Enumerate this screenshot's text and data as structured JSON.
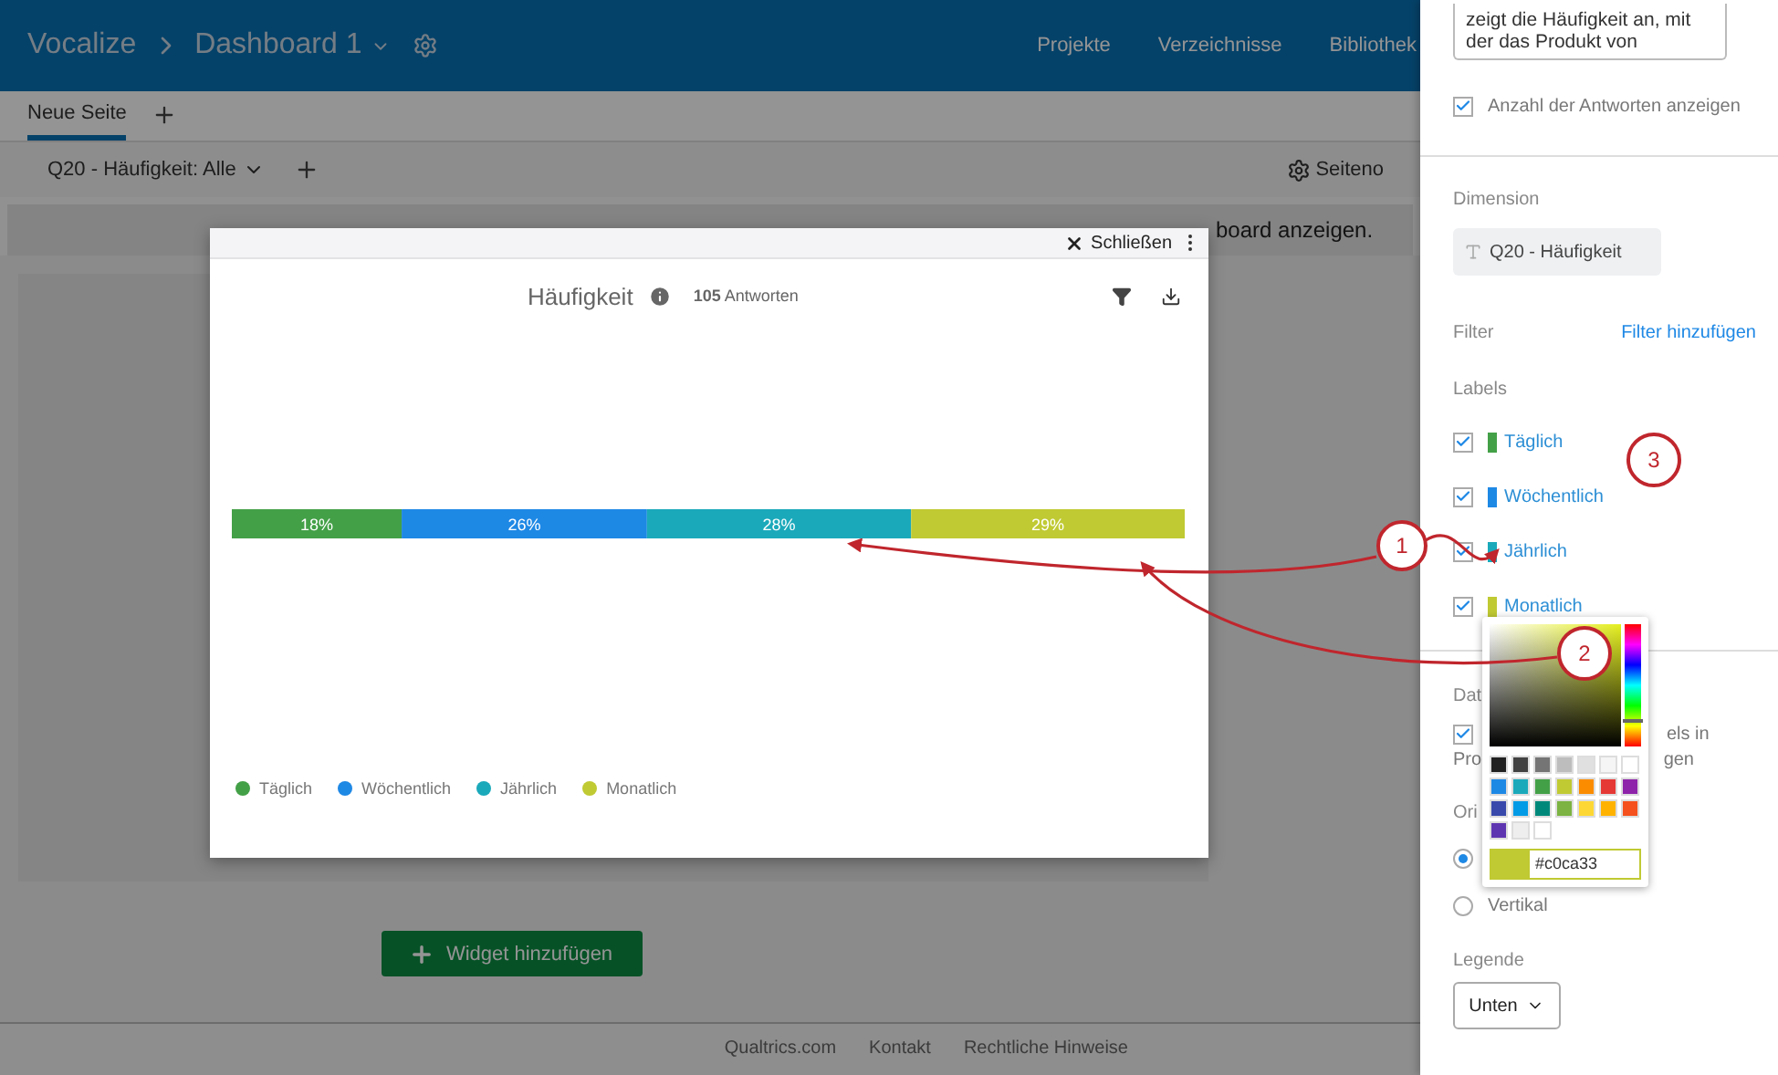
{
  "header": {
    "app": "Vocalize",
    "dashboard": "Dashboard 1",
    "nav": [
      "Projekte",
      "Verzeichnisse",
      "Bibliothek"
    ]
  },
  "page_tabs": [
    {
      "label": "Neue Seite",
      "selected": true
    }
  ],
  "filter_bar": {
    "filter": "Q20 - Häufigkeit: Alle",
    "settings": "Seiteno"
  },
  "banner": {
    "text": "board anzeigen."
  },
  "widget_button": "Widget hinzufügen",
  "footer": [
    "Qualtrics.com",
    "Kontakt",
    "Rechtliche Hinweise"
  ],
  "modal": {
    "close": "Schließen",
    "title": "Häufigkeit",
    "count": "105",
    "count_label": "Antworten",
    "chart_data": {
      "type": "bar",
      "orientation": "horizontal",
      "stacked": true,
      "data_labels": "value_labels",
      "series": [
        {
          "name": "Täglich",
          "color": "#43a047",
          "values": [
            18
          ],
          "value_labels": [
            "18%"
          ]
        },
        {
          "name": "Wöchentlich",
          "color": "#1e88e5",
          "values": [
            26
          ],
          "value_labels": [
            "26%"
          ]
        },
        {
          "name": "Jährlich",
          "color": "#1aa9bb",
          "values": [
            28
          ],
          "value_labels": [
            "28%"
          ]
        },
        {
          "name": "Monatlich",
          "color": "#c0ca33",
          "values": [
            29
          ],
          "value_labels": [
            "29%"
          ]
        }
      ]
    }
  },
  "panel": {
    "description_lines": [
      "zeigt die Häufigkeit an, mit",
      "der das Produkt von"
    ],
    "show_count": {
      "label": "Anzahl der Antworten anzeigen",
      "checked": true
    },
    "dimension_title": "Dimension",
    "dimension": "Q20 - Häufigkeit",
    "filter_title": "Filter",
    "filter_link": "Filter hinzufügen",
    "labels_title": "Labels",
    "labels": [
      {
        "label": "Täglich",
        "color": "#43a047",
        "checked": true
      },
      {
        "label": "Wöchentlich",
        "color": "#1e88e5",
        "checked": true
      },
      {
        "label": "Jährlich",
        "color": "#1aa9bb",
        "checked": true
      },
      {
        "label": "Monatlich",
        "color": "#c0ca33",
        "checked": true
      }
    ],
    "data_title": "Dat",
    "percent_option": {
      "checked": true,
      "fragments": [
        "els in",
        "Pro",
        "gen"
      ]
    },
    "orientation_title": "Ori",
    "orientations": [
      {
        "selected": true
      },
      {
        "label": "Vertikal",
        "selected": false
      }
    ],
    "legend_title": "Legende",
    "legend_value": "Unten"
  },
  "color_picker": {
    "value": "#c0ca33",
    "hue": {
      "level": 0.22
    },
    "swatches": [
      {
        "color": "#212121"
      },
      {
        "color": "#424242"
      },
      {
        "color": "#757575"
      },
      {
        "color": "#bdbdbd"
      },
      {
        "color": "#e0e0e0"
      },
      {
        "color": "#f5f5f5"
      },
      {
        "color": "#ffffff"
      },
      {
        "color": "#1e88e5"
      },
      {
        "color": "#1aa9bb"
      },
      {
        "color": "#43a047"
      },
      {
        "color": "#c0ca33"
      },
      {
        "color": "#fb8c00"
      },
      {
        "color": "#e53935"
      },
      {
        "color": "#8e24aa"
      },
      {
        "color": "#3949ab"
      },
      {
        "color": "#039be5"
      },
      {
        "color": "#00897b"
      },
      {
        "color": "#7cb342"
      },
      {
        "color": "#fdd835"
      },
      {
        "color": "#ffb300"
      },
      {
        "color": "#f4511e"
      },
      {
        "color": "#5e35b1"
      },
      {
        "color": "#eeeeee"
      },
      {
        "color": "#ffffff"
      }
    ]
  },
  "annotations": [
    {
      "label": "1"
    },
    {
      "label": "2"
    },
    {
      "label": "3"
    }
  ]
}
